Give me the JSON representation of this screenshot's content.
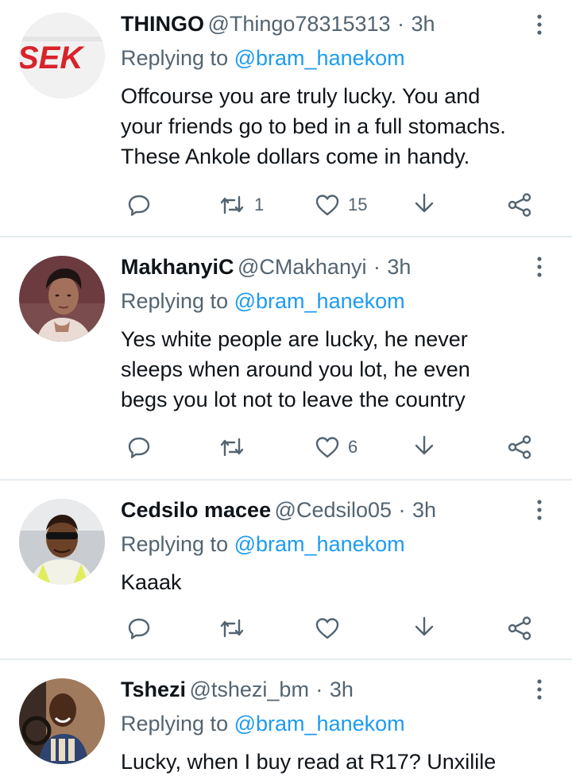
{
  "tweets": [
    {
      "name": "THINGO",
      "handle": "@Thingo78315313",
      "separator": "·",
      "time": "3h",
      "replying_prefix": "Replying to",
      "replying_to": "@bram_hanekom",
      "text_lines": [
        "Offcourse you are truly lucky. You and",
        "your friends go to bed in a full stomachs.",
        "These Ankole dollars come in handy."
      ],
      "avatar_text": "SEK",
      "replies": "",
      "retweets": "1",
      "likes": "15"
    },
    {
      "name": "MakhanyiC",
      "handle": "@CMakhanyi",
      "separator": "·",
      "time": "3h",
      "replying_prefix": "Replying to",
      "replying_to": "@bram_hanekom",
      "text_lines": [
        "Yes white people are lucky, he never",
        "sleeps when around you lot, he even",
        "begs you lot not to leave the country"
      ],
      "replies": "",
      "retweets": "",
      "likes": "6"
    },
    {
      "name": "Cedsilo macee",
      "handle": "@Cedsilo05",
      "separator": "·",
      "time": "3h",
      "replying_prefix": "Replying to",
      "replying_to": "@bram_hanekom",
      "text_lines": [
        "Kaaak"
      ],
      "replies": "",
      "retweets": "",
      "likes": ""
    },
    {
      "name": "Tshezi",
      "handle": "@tshezi_bm",
      "separator": "·",
      "time": "3h",
      "replying_prefix": "Replying to",
      "replying_to": "@bram_hanekom",
      "text_lines": [
        "Lucky, when I buy read at R17? Unxilile"
      ],
      "replies": "",
      "retweets": "",
      "likes": ""
    }
  ],
  "colors": {
    "text": "#0f1419",
    "secondary": "#536471",
    "mention": "#1d9bf0",
    "divider": "#e6ecf0",
    "logo_red": "#d8232a"
  },
  "icons": {
    "more": "more-vertical-icon",
    "reply": "reply-bubble-icon",
    "retweet": "retweet-arrows-icon",
    "like": "heart-icon",
    "bookmark": "bookmark-arrow-icon",
    "share": "share-nodes-icon"
  }
}
